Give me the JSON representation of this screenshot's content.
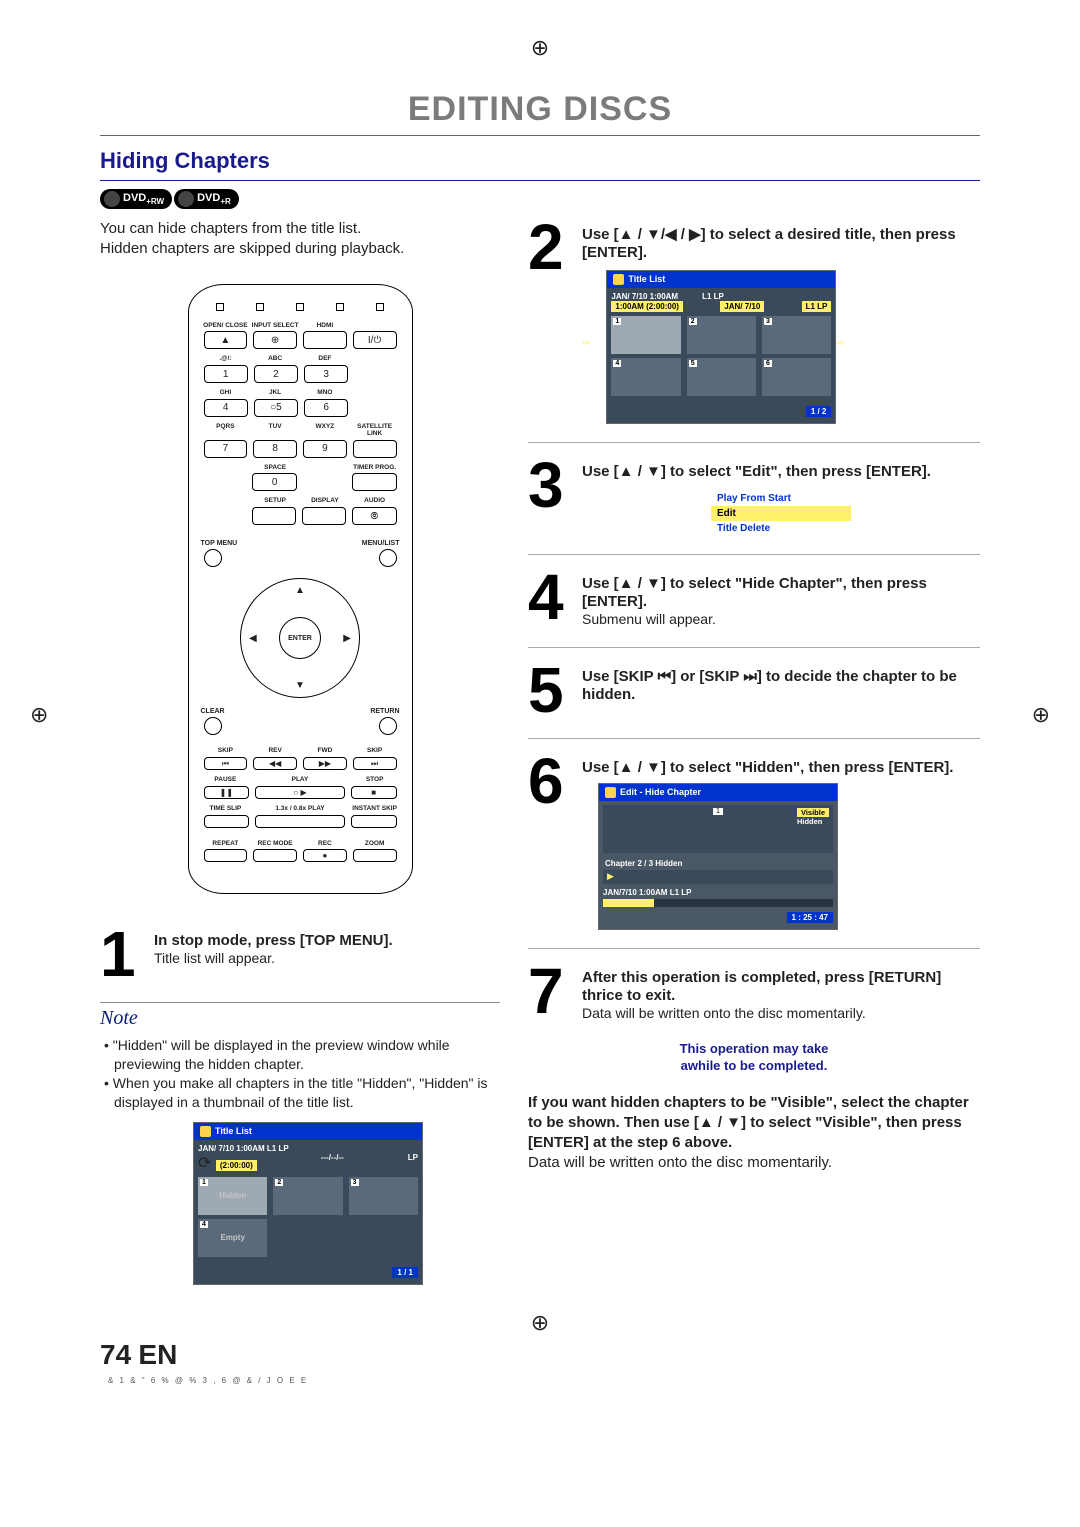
{
  "page": {
    "title": "EDITING DISCS",
    "section": "Hiding Chapters",
    "intro1": "You can hide chapters from the title list.",
    "intro2": "Hidden chapters are skipped during playback.",
    "page_number": "74",
    "lang": "EN",
    "foot_code": "& 1 & \" 6 % @ % 3     , 6 @ & /   J O E E"
  },
  "badges": {
    "a": "DVD",
    "a_sub": "+RW",
    "b": "DVD",
    "b_sub": "+R"
  },
  "remote": {
    "open_close": "OPEN/\nCLOSE",
    "input_select": "INPUT\nSELECT",
    "hdmi": "HDMI",
    "abc": "ABC",
    "def": "DEF",
    "ghi": "GHI",
    "jkl": "JKL",
    "mno": "MNO",
    "pqrs": "PQRS",
    "tuv": "TUV",
    "wxyz": "WXYZ",
    "sym": ".@/:",
    "satlink": "SATELLITE\nLINK",
    "space": "SPACE",
    "timer_prog": "TIMER\nPROG.",
    "setup": "SETUP",
    "display": "DISPLAY",
    "audio": "AUDIO",
    "top_menu": "TOP MENU",
    "menu_list": "MENU/LIST",
    "enter": "ENTER",
    "clear": "CLEAR",
    "return": "RETURN",
    "skip": "SKIP",
    "rev": "REV",
    "fwd": "FWD",
    "pause": "PAUSE",
    "play": "PLAY",
    "stop": "STOP",
    "time_slip": "TIME SLIP",
    "playvar": "1.3x / 0.8x PLAY",
    "instant_skip": "INSTANT SKIP",
    "repeat": "REPEAT",
    "rec_mode": "REC MODE",
    "rec": "REC",
    "zoom": "ZOOM"
  },
  "steps": {
    "s1": {
      "num": "1",
      "text": "In stop mode, press [TOP MENU].",
      "sub": "Title list will appear."
    },
    "s2": {
      "num": "2",
      "text": "Use [▲ / ▼/◀ / ▶] to select a desired title, then press [ENTER]."
    },
    "s3": {
      "num": "3",
      "text": "Use [▲ / ▼] to select \"Edit\", then press [ENTER]."
    },
    "s4": {
      "num": "4",
      "text": "Use [▲ / ▼] to select \"Hide Chapter\", then press [ENTER].",
      "sub": "Submenu will appear."
    },
    "s5": {
      "num": "5",
      "text": "Use [SKIP ⏮] or [SKIP ⏭] to decide the chapter to be hidden."
    },
    "s6": {
      "num": "6",
      "text": "Use [▲ / ▼] to select \"Hidden\", then press [ENTER]."
    },
    "s7": {
      "num": "7",
      "text": "After this operation is completed, press [RETURN] thrice to exit.",
      "sub": "Data will be written onto the disc momentarily."
    }
  },
  "osd_title_list": {
    "title": "Title List",
    "meta_top_left": "JAN/ 7/10 1:00AM",
    "meta_top_right": "L1   LP",
    "hl_left": "1:00AM (2:00:00)",
    "hl_right_a": "JAN/ 7/10",
    "hl_right_b": "L1   LP",
    "page": "1 / 2",
    "tn1": "1",
    "tn2": "2",
    "tn3": "3",
    "tn4": "4",
    "tn5": "5",
    "tn6": "6"
  },
  "menu": {
    "m1": "Play From Start",
    "m2": "Edit",
    "m3": "Title Delete"
  },
  "ehc": {
    "title": "Edit - Hide Chapter",
    "pn": "1",
    "visible": "Visible",
    "hidden": "Hidden",
    "chapter": "Chapter    2 / 3    Hidden",
    "meta": "JAN/7/10 1:00AM L1   LP",
    "tcode": "1 : 25 : 47"
  },
  "caution": {
    "l1": "This operation may take",
    "l2": "awhile to be completed."
  },
  "after": {
    "bold": "If you want hidden chapters to be \"Visible\", select the chapter to be shown. Then use [▲ / ▼] to select \"Visible\", then press [ENTER] at the step 6 above.",
    "sub": "Data will be written onto the disc momentarily."
  },
  "note": {
    "title": "Note",
    "li1": "\"Hidden\" will be displayed in the preview window while previewing the hidden chapter.",
    "li2": "When you make all chapters in the title \"Hidden\", \"Hidden\" is displayed in a thumbnail of the title list."
  },
  "osd_note": {
    "title": "Title List",
    "meta_top": "JAN/ 7/10 1:00AM  L1  LP",
    "hl_left": "(2:00:00)",
    "hl_mid": "---/--/--",
    "hl_right": "LP",
    "tn1": "1",
    "tn2": "2",
    "tn3": "3",
    "tn4": "4",
    "hidden": "Hidden",
    "empty": "Empty",
    "page": "1 / 1"
  }
}
